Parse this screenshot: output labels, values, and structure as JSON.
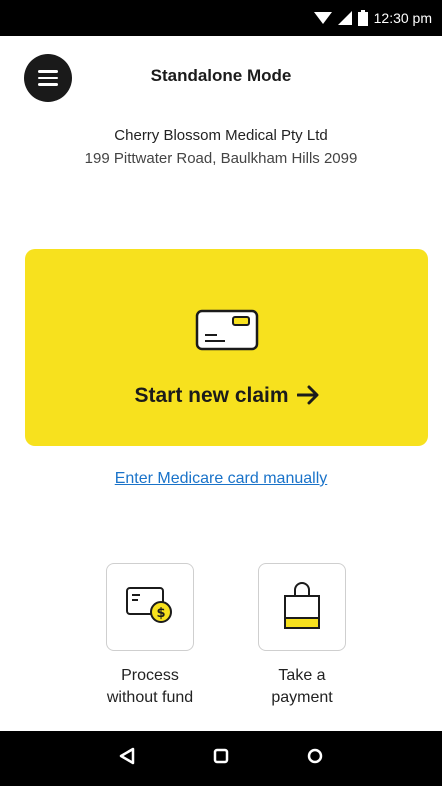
{
  "status_bar": {
    "time": "12:30 pm",
    "icons": [
      "wifi-icon",
      "signal-icon",
      "battery-icon"
    ]
  },
  "header": {
    "title": "Standalone Mode",
    "menu_icon": "menu-icon"
  },
  "merchant": {
    "name": "Cherry Blossom Medical Pty Ltd",
    "address": "199 Pittwater Road, Baulkham Hills 2099"
  },
  "claim_card": {
    "label": "Start new claim",
    "icon": "card-icon",
    "arrow": "arrow-right-icon",
    "color": "#f7e11e"
  },
  "manual_link": {
    "label": "Enter Medicare card manually",
    "color": "#1a73c9"
  },
  "tiles": [
    {
      "label_line1": "Process",
      "label_line2": "without fund",
      "icon": "card-dollar-icon"
    },
    {
      "label_line1": "Take a",
      "label_line2": "payment",
      "icon": "shopping-bag-icon"
    }
  ],
  "nav_bar": {
    "buttons": [
      "back-icon",
      "home-icon",
      "recents-icon"
    ]
  }
}
